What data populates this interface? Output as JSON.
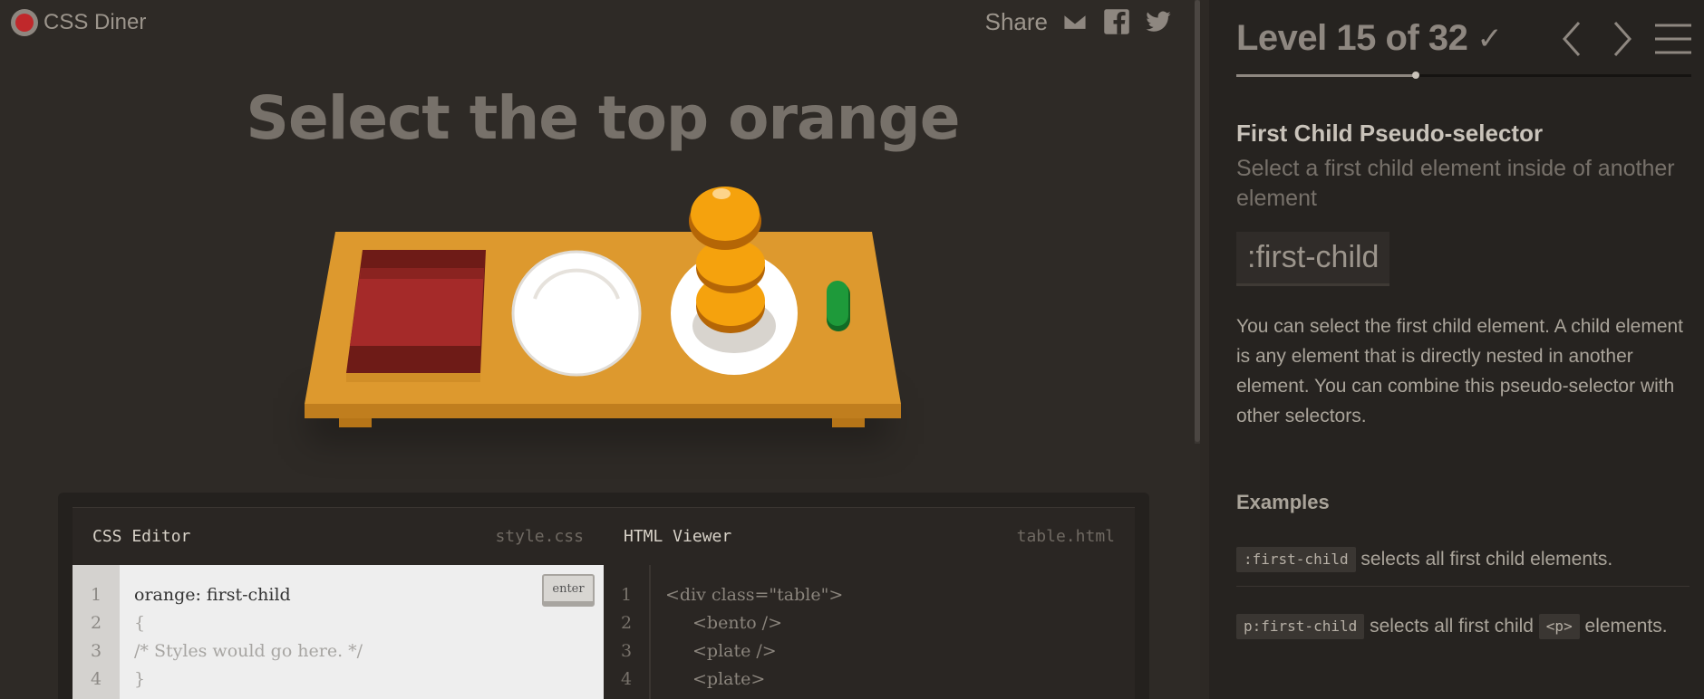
{
  "app": {
    "name": "CSS Diner"
  },
  "share": {
    "label": "Share",
    "icons": [
      "mail-icon",
      "facebook-icon",
      "twitter-icon"
    ]
  },
  "game": {
    "order": "Select the top orange",
    "table_items": [
      "bento",
      "plate",
      "plate with stacked oranges",
      "pickle"
    ]
  },
  "editor": {
    "css": {
      "title": "CSS Editor",
      "file": "style.css",
      "enter_label": "enter",
      "line_numbers": [
        "1",
        "2",
        "3",
        "4"
      ],
      "input": "orange: first-child",
      "brace_open": "{",
      "comment": "/* Styles would go here. */",
      "brace_close": "}"
    },
    "html": {
      "title": "HTML Viewer",
      "file": "table.html",
      "line_numbers": [
        "1",
        "2",
        "3",
        "4"
      ],
      "lines": [
        "<div class=\"table\">",
        "<bento />",
        "<plate />",
        "<plate>"
      ]
    }
  },
  "sidebar": {
    "level_title": "Level 15 of 32",
    "completed_mark": "✓",
    "progress": {
      "current": 15,
      "total": 32
    },
    "selector_name": "First Child Pseudo-selector",
    "title": "Select a first child element inside of another element",
    "syntax": ":first-child",
    "hint": "You can select the first child element. A child element is any element that is directly nested in another element. You can combine this pseudo-selector with other selectors.",
    "examples_heading": "Examples",
    "examples": [
      {
        "code": ":first-child",
        "text": " selects all first child elements."
      },
      {
        "code": "p:first-child",
        "text": " selects all first child ",
        "code2": "<p>",
        "text2": " elements."
      }
    ]
  },
  "colors": {
    "background": "#2e2a26",
    "sidebar": "#262320",
    "table": "#dd992e",
    "orange": "#f5a20d",
    "pickle": "#1e9a3a",
    "bento": "#9c2826"
  }
}
